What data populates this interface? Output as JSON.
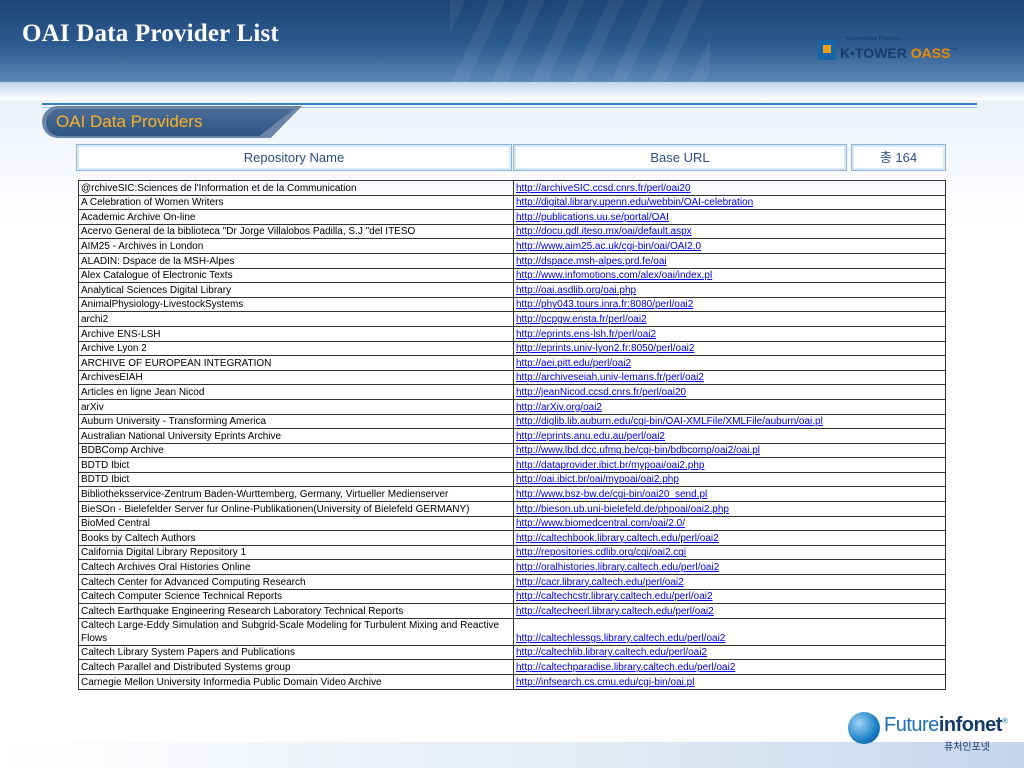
{
  "page": {
    "title": "OAI Data Provider List",
    "section_label": "OAI Data Providers"
  },
  "logos": {
    "ktower": {
      "tagline": "Knowledge Frontier",
      "main": "K•TOWER",
      "accent": "OASS",
      "tm": "™"
    },
    "futureinfonet": {
      "name_a": "Future",
      "name_b": "infonet",
      "reg": "®",
      "korean": "퓨처인포넷"
    }
  },
  "table": {
    "headers": {
      "name": "Repository Name",
      "url": "Base URL",
      "count": "총 164"
    },
    "rows": [
      {
        "name": "@rchiveSIC:Sciences de l'Information et de la Communication",
        "url": "http://archiveSIC.ccsd.cnrs.fr/perl/oai20"
      },
      {
        "name": "A Celebration of Women Writers",
        "url": "http://digital.library.upenn.edu/webbin/OAI-celebration"
      },
      {
        "name": "Academic Archive On-line",
        "url": "http://publications.uu.se/portal/OAI"
      },
      {
        "name": "Acervo General de la biblioteca \"Dr Jorge Villalobos Padilla, S.J \"del ITESO",
        "url": "http://docu.gdl.iteso.mx/oai/default.aspx"
      },
      {
        "name": "AIM25 - Archives in London",
        "url": "http://www.aim25.ac.uk/cgi-bin/oai/OAI2.0"
      },
      {
        "name": "ALADIN: Dspace de la MSH-Alpes",
        "url": "http://dspace.msh-alpes.prd.fe/oai"
      },
      {
        "name": "Alex Catalogue of Electronic Texts",
        "url": "http://www.infomotions.com/alex/oai/index.pl"
      },
      {
        "name": "Analytical Sciences Digital Library",
        "url": "http://oai.asdlib.org/oai.php"
      },
      {
        "name": "AnimalPhysiology-LivestockSystems",
        "url": "http://phy043.tours.inra.fr:8080/perl/oai2"
      },
      {
        "name": "archi2",
        "url": "http://pcpgw.ensta.fr/perl/oai2"
      },
      {
        "name": "Archive ENS-LSH",
        "url": "http://eprints.ens-lsh.fr/perl/oai2"
      },
      {
        "name": "Archive Lyon 2",
        "url": "http://eprints.univ-lyon2.fr:8050/perl/oai2"
      },
      {
        "name": "ARCHIVE OF EUROPEAN INTEGRATION",
        "url": "http://aei.pitt.edu/perl/oai2"
      },
      {
        "name": "ArchivesEIAH",
        "url": "http://archiveseiah.univ-lemans.fr/perl/oai2"
      },
      {
        "name": "Articles en ligne Jean Nicod",
        "url": "http://jeanNicod.ccsd.cnrs.fr/perl/oai20"
      },
      {
        "name": "arXiv",
        "url": "http://arXiv.org/oai2"
      },
      {
        "name": "Auburn University - Transforming America",
        "url": "http://diglib.lib.auburn.edu/cgi-bin/OAI-XMLFile/XMLFile/auburn/oai.pl"
      },
      {
        "name": "Australian National University Eprints Archive",
        "url": "http://eprints.anu.edu.au/perl/oai2"
      },
      {
        "name": "BDBComp Archive",
        "url": "http://www.lbd.dcc.ufmg.be/cgi-bin/bdbcomp/oai2/oai.pl"
      },
      {
        "name": "BDTD Ibict",
        "url": "http://dataprovider.ibict.br/mypoai/oai2.php"
      },
      {
        "name": "BDTD Ibict",
        "url": "http://oai.ibict.br/oai/mypoai/oai2.php"
      },
      {
        "name": "Bibliotheksservice-Zentrum Baden-Wurttemberg, Germany, Virtueller Medienserver",
        "url": "http://www.bsz-bw.de/cgi-bin/oai20_send.pl"
      },
      {
        "name": "BieSOn - Bielefelder Server fur Online-Publikationen(University of Bielefeld GERMANY)",
        "url": "http://bieson.ub.uni-bielefeld.de/phpoai/oai2.php"
      },
      {
        "name": "BioMed Central",
        "url": "http://www.biomedcentral.com/oai/2.0/"
      },
      {
        "name": "Books by Caltech Authors",
        "url": "http://caltechbook.library.caltech.edu/perl/oai2"
      },
      {
        "name": "California Digital Library Repository 1",
        "url": "http://repositories.cdlib.org/cgi/oai2.cgi"
      },
      {
        "name": "Caltech Archives Oral Histories Online",
        "url": "http://oralhistories.library.caltech.edu/perl/oai2"
      },
      {
        "name": "Caltech Center for Advanced Computing Research",
        "url": "http://cacr.library.caltech.edu/perl/oai2"
      },
      {
        "name": "Caltech Computer Science Technical Reports",
        "url": "http://caltechcstr.library.caltech.edu/perl/oai2"
      },
      {
        "name": "Caltech Earthquake Engineering Research Laboratory Technical Reports",
        "url": "http://caltecheerl.library.caltech.edu/perl/oai2"
      },
      {
        "name": "Caltech Large-Eddy Simulation and Subgrid-Scale Modeling for Turbulent Mixing and Reactive Flows",
        "url": "http://caltechlessgs.library.caltech.edu/perl/oai2"
      },
      {
        "name": "Caltech Library System Papers and Publications",
        "url": "http://caltechlib.library.caltech.edu/perl/oai2"
      },
      {
        "name": "Caltech Parallel and Distributed Systems group",
        "url": "http://caltechparadise.library.caltech.edu/perl/oai2"
      },
      {
        "name": "Carnegie Mellon University Informedia Public Domain Video Archive",
        "url": "http://infsearch.cs.cmu.edu/cgi-bin/oai.pl"
      }
    ]
  },
  "colors": {
    "topbar": "#2d5b8f",
    "section_label": "#ffb020",
    "link": "#0000ee",
    "header_text": "#2b4e8a"
  }
}
